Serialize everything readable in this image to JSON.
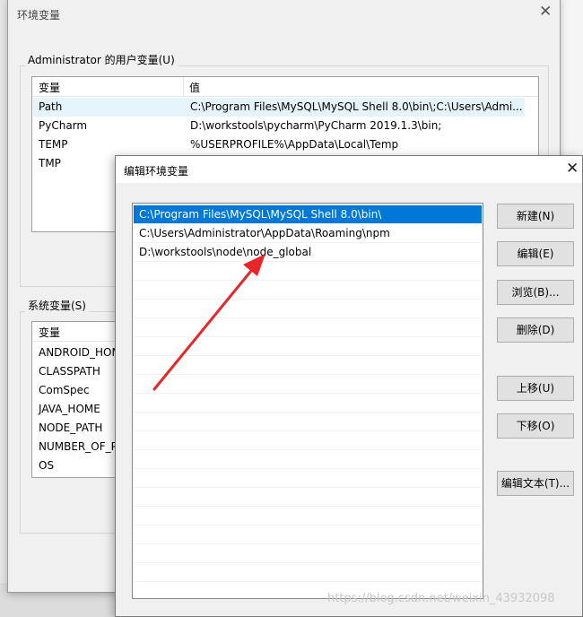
{
  "env_window": {
    "title": "环境变量",
    "user_group_label": "Administrator 的用户变量(U)",
    "user_columns": [
      "变量",
      "值"
    ],
    "user_rows": [
      {
        "name": "Path",
        "value": "C:\\Program Files\\MySQL\\MySQL Shell 8.0\\bin\\;C:\\Users\\Admi..."
      },
      {
        "name": "PyCharm",
        "value": "D:\\workstools\\pycharm\\PyCharm 2019.1.3\\bin;"
      },
      {
        "name": "TEMP",
        "value": "%USERPROFILE%\\AppData\\Local\\Temp"
      },
      {
        "name": "TMP",
        "value": ""
      }
    ],
    "system_group_label": "系统变量(S)",
    "system_columns": [
      "变量"
    ],
    "system_rows": [
      "ANDROID_HOM",
      "CLASSPATH",
      "ComSpec",
      "JAVA_HOME",
      "NODE_PATH",
      "NUMBER_OF_P",
      "OS"
    ]
  },
  "edit_dialog": {
    "title": "编辑环境变量",
    "entries": [
      "C:\\Program Files\\MySQL\\MySQL Shell 8.0\\bin\\",
      "C:\\Users\\Administrator\\AppData\\Roaming\\npm",
      "D:\\workstools\\node\\node_global"
    ],
    "selected_index": 0,
    "buttons": {
      "new": "新建(N)",
      "edit": "编辑(E)",
      "browse": "浏览(B)...",
      "delete": "删除(D)",
      "move_up": "上移(U)",
      "move_down": "下移(O)",
      "edit_text": "编辑文本(T)..."
    }
  },
  "watermark": "https://blog.csdn.net/weixin_43932098",
  "colors": {
    "selection": "#0078d7",
    "arrow": "#e8262a"
  }
}
